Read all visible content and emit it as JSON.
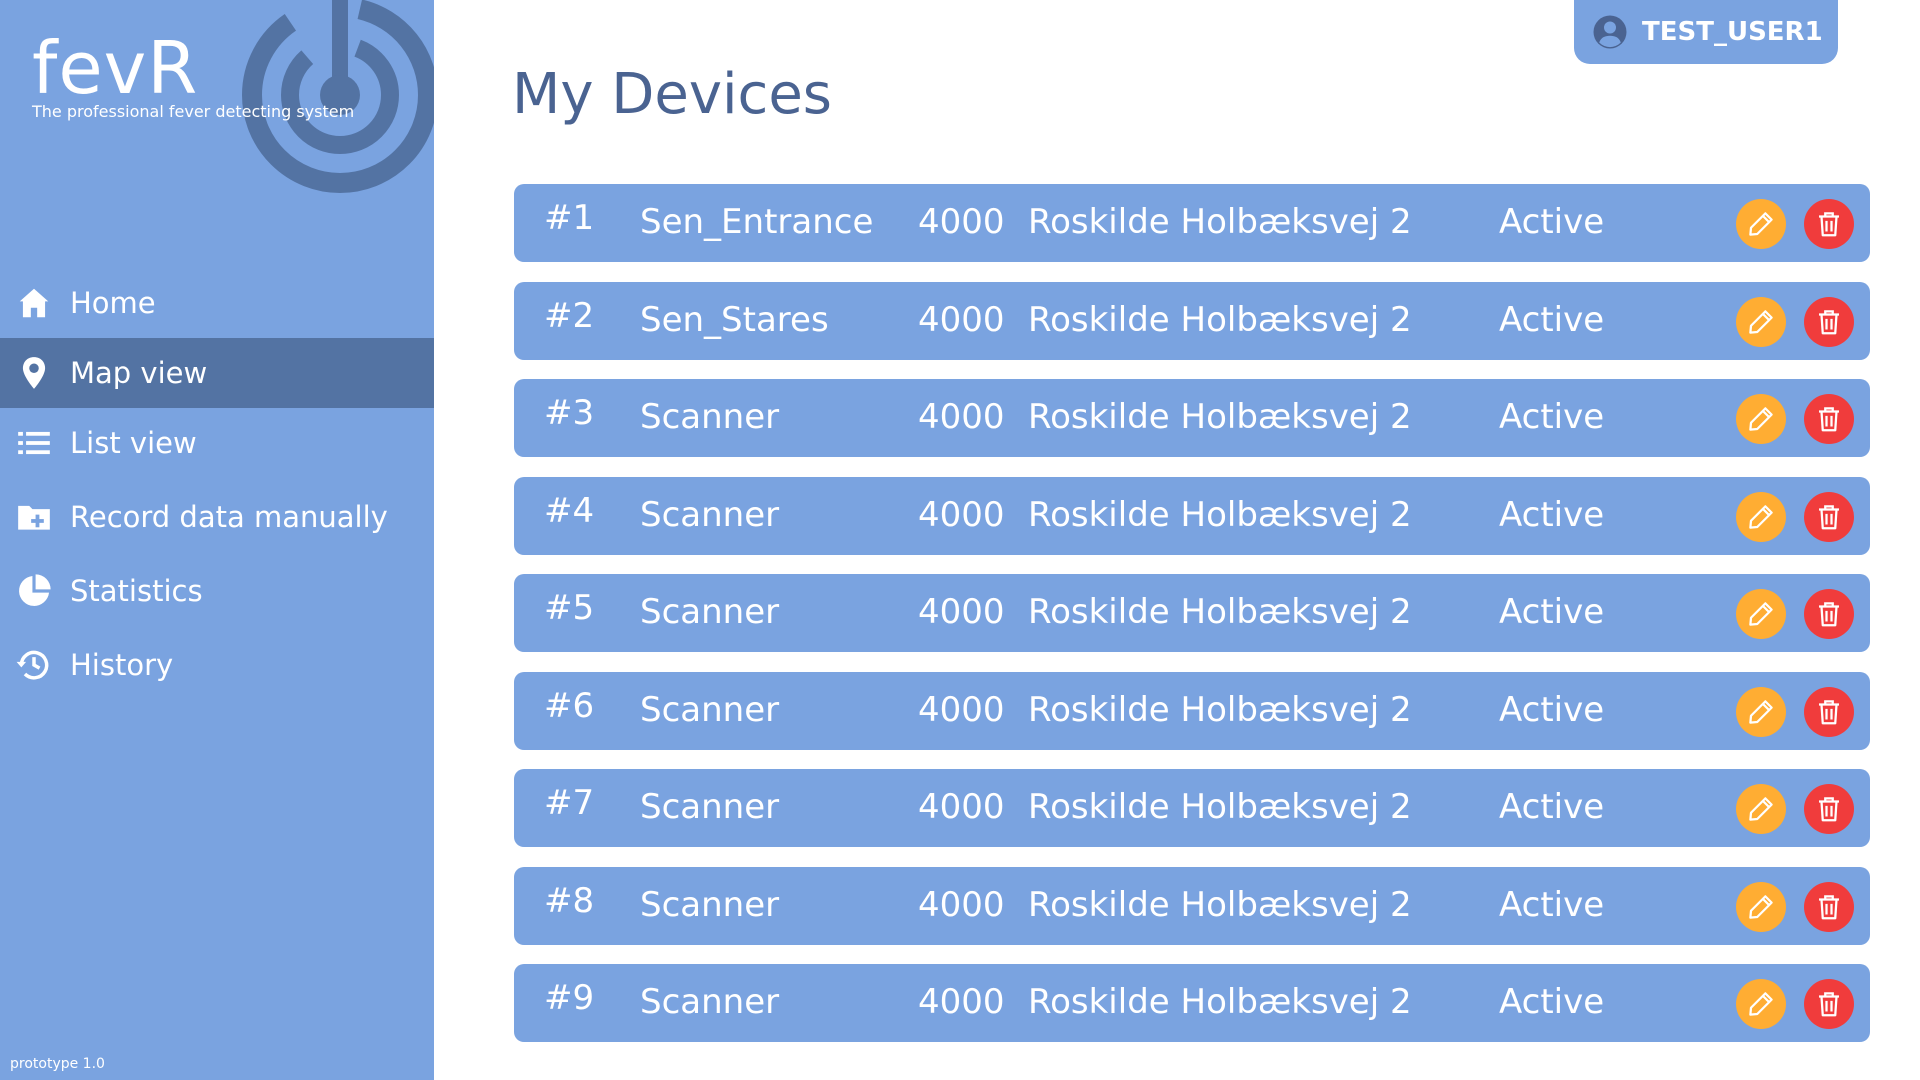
{
  "brand": {
    "name": "fevR",
    "tagline": "The professional fever detecting system",
    "accent_color": "#7aa3e0",
    "logo_color": "#5373a3"
  },
  "sidebar": {
    "items": [
      {
        "label": "Home",
        "icon": "home-icon",
        "active": false
      },
      {
        "label": "Map view",
        "icon": "map-pin-icon",
        "active": true
      },
      {
        "label": "List view",
        "icon": "list-icon",
        "active": false
      },
      {
        "label": "Record data manually",
        "icon": "folder-plus-icon",
        "active": false
      },
      {
        "label": "Statistics",
        "icon": "pie-chart-icon",
        "active": false
      },
      {
        "label": "History",
        "icon": "history-icon",
        "active": false
      }
    ],
    "version": "prototype 1.0"
  },
  "user": {
    "name": "TEST_USER1",
    "icon": "user-circle-icon"
  },
  "main": {
    "title": "My Devices",
    "devices": [
      {
        "id": "#1",
        "name": "Sen_Entrance",
        "zip": "4000",
        "address": "Roskilde Holbæksvej 2",
        "status": "Active"
      },
      {
        "id": "#2",
        "name": "Sen_Stares",
        "zip": "4000",
        "address": "Roskilde Holbæksvej 2",
        "status": "Active"
      },
      {
        "id": "#3",
        "name": "Scanner",
        "zip": "4000",
        "address": "Roskilde Holbæksvej 2",
        "status": "Active"
      },
      {
        "id": "#4",
        "name": "Scanner",
        "zip": "4000",
        "address": "Roskilde Holbæksvej 2",
        "status": "Active"
      },
      {
        "id": "#5",
        "name": "Scanner",
        "zip": "4000",
        "address": "Roskilde Holbæksvej 2",
        "status": "Active"
      },
      {
        "id": "#6",
        "name": "Scanner",
        "zip": "4000",
        "address": "Roskilde Holbæksvej 2",
        "status": "Active"
      },
      {
        "id": "#7",
        "name": "Scanner",
        "zip": "4000",
        "address": "Roskilde Holbæksvej 2",
        "status": "Active"
      },
      {
        "id": "#8",
        "name": "Scanner",
        "zip": "4000",
        "address": "Roskilde Holbæksvej 2",
        "status": "Active"
      },
      {
        "id": "#9",
        "name": "Scanner",
        "zip": "4000",
        "address": "Roskilde Holbæksvej 2",
        "status": "Active"
      }
    ],
    "edit_icon": "pencil-icon",
    "delete_icon": "trash-icon",
    "edit_color": "#ffad33",
    "delete_color": "#f03c3c"
  }
}
